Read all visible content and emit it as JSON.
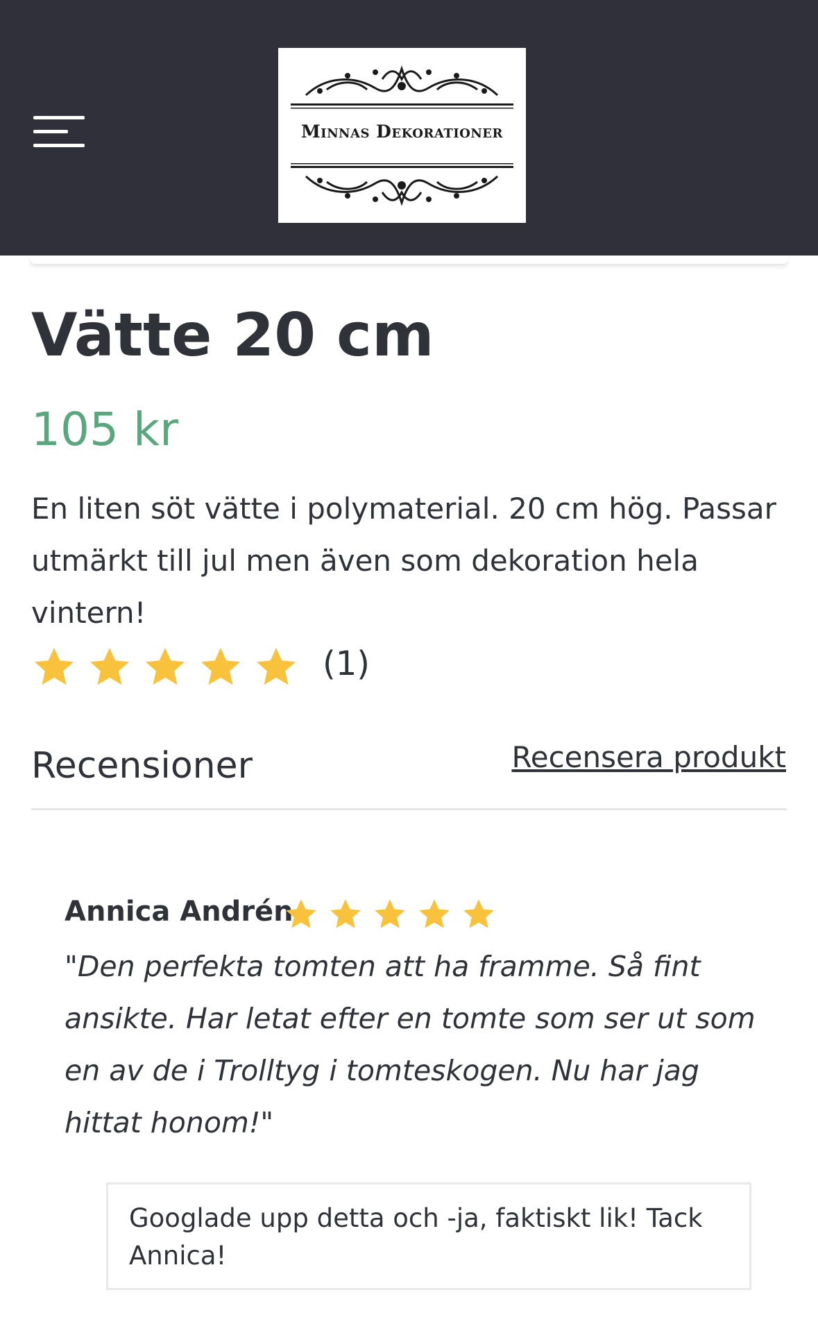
{
  "header": {
    "brand": "Minnas Dekorationer",
    "colors": {
      "background": "#2f3039",
      "menu_icon": "#ffffff"
    }
  },
  "product": {
    "title": "Vätte 20 cm",
    "price": "105 kr",
    "description": "En liten söt vätte i polymaterial. 20 cm hög. Passar utmärkt till jul men även som dekoration hela vintern!",
    "rating": {
      "stars": 5,
      "max": 5,
      "count_label": "(1)"
    },
    "colors": {
      "price": "#5aa77e",
      "star": "#f9c23c"
    }
  },
  "reviews": {
    "heading": "Recensioner",
    "write_review_label": "Recensera produkt",
    "items": [
      {
        "author": "Annica Andrén",
        "stars": 5,
        "text": "\"Den perfekta tomten att ha framme. Så fint ansikte. Har letat efter en tomte som ser ut som en av de i Trolltyg i tomteskogen. Nu har jag hittat honom!\"",
        "reply": "Googlade upp detta och -ja, faktiskt lik! Tack Annica!"
      }
    ]
  }
}
